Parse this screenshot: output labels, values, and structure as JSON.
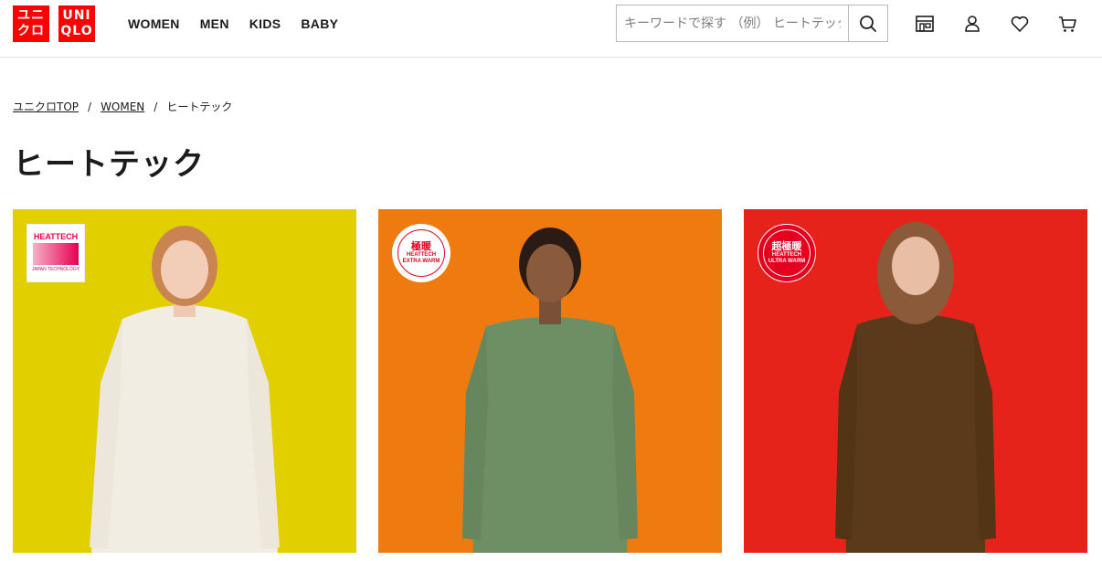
{
  "header": {
    "logo_jp": [
      "ユニ",
      "クロ"
    ],
    "logo_en": [
      "UNI",
      "QLO"
    ],
    "nav": [
      "WOMEN",
      "MEN",
      "KIDS",
      "BABY"
    ],
    "search_placeholder": "キーワードで探す （例） ヒートテック"
  },
  "breadcrumb": {
    "items": [
      "ユニクロTOP",
      "WOMEN",
      "ヒートテック"
    ],
    "separator": "/"
  },
  "page_title": "ヒートテック",
  "products": [
    {
      "badge_title": "HEATTECH",
      "badge_sub": "JAPAN TECHNOLOGY",
      "color": "#e2cf00",
      "shirt_color": "#f1ede2"
    },
    {
      "badge_jp": "極暖",
      "badge_en": [
        "HEATTECH",
        "EXTRA WARM"
      ],
      "color": "#ee7a10",
      "shirt_color": "#6e8f64"
    },
    {
      "badge_jp": "超極暖",
      "badge_en": [
        "HEATTECH",
        "ULTRA WARM"
      ],
      "color": "#e5231b",
      "shirt_color": "#5a3a1a"
    }
  ],
  "colors": {
    "brand_red": "#ff0000"
  }
}
